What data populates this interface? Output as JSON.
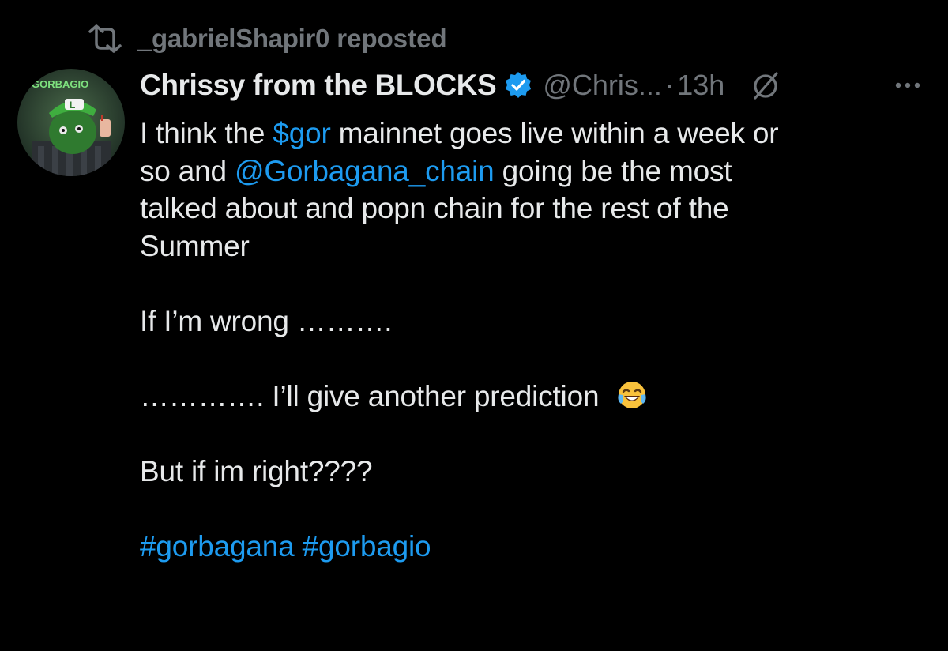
{
  "repost": {
    "by": "_gabrielShapir0",
    "label": "reposted"
  },
  "author": {
    "display_name": "Chrissy from the BLOCKS",
    "handle": "@Chris...",
    "separator": "·",
    "time": "13h",
    "avatar_text": "GORBAGIO",
    "verified": true
  },
  "tweet": {
    "line1_pre": "I think the ",
    "line1_cashtag": "$gor",
    "line1_post": " mainnet goes live within a week or",
    "line2_pre": "so and ",
    "line2_mention": "@Gorbagana_chain",
    "line2_post": " going be the most",
    "line3": "talked about and popn chain for the rest of the",
    "line4": "Summer",
    "line5": "If I’m wrong ……….",
    "line6": "…………. I’ll give another prediction",
    "line6_emoji": "😂",
    "line7": "But if im right????",
    "hashtag1": "#gorbagana",
    "hashtag2": "#gorbagio"
  },
  "colors": {
    "background": "#000000",
    "text": "#e7e9ea",
    "muted": "#71767b",
    "link": "#1d9bf0",
    "verified": "#1d9bf0"
  },
  "icons": {
    "repost": "repost-icon",
    "verified": "verified-badge-icon",
    "grok": "grok-icon",
    "more": "more-horizontal-icon",
    "emoji": "face-with-tears-of-joy-emoji"
  }
}
